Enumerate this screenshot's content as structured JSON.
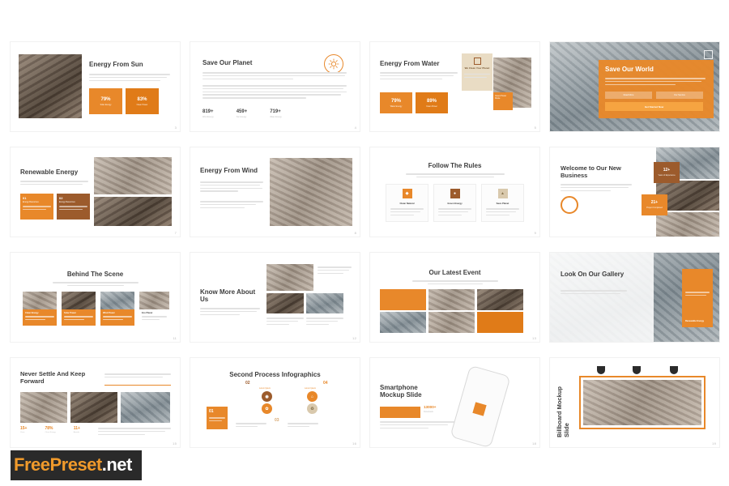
{
  "watermark": {
    "brand": "FreePreset",
    "suffix": ".net"
  },
  "palette": {
    "orange": "#e8882a",
    "orange_dark": "#e07b18",
    "brown": "#9c5b2c",
    "tan": "#d9c9ad",
    "text_dark": "#3d3d3d",
    "body_gray": "#bdbdbd",
    "page_bg": "#ffffff"
  },
  "body_text": "Lorem ipsum dolor sit amet, consectetur adipiscing elit, sed do eiusmod tempor incididunt ut labore et dolore magna aliqua. Ut enim ad minim veniam.",
  "slides": [
    {
      "number": "3",
      "title": "Energy From Sun",
      "stats": [
        {
          "value": "79%",
          "label": "Solar Energy"
        },
        {
          "value": "83%",
          "label": "Clean Power"
        }
      ]
    },
    {
      "number": "4",
      "title": "Save Our Planet",
      "stats": [
        {
          "value": "819+",
          "label": "Wind Energy"
        },
        {
          "value": "459+",
          "label": "Sun Energy"
        },
        {
          "value": "719+",
          "label": "Water Energy"
        }
      ],
      "icon": "sun-burst-icon"
    },
    {
      "number": "5",
      "title": "Energy From Water",
      "sidebar_title": "We Clean Your Planet",
      "sidebar_tag": "Green Power Route",
      "stats": [
        {
          "value": "79%",
          "label": "Water Energy"
        },
        {
          "value": "89%",
          "label": "Clean Power"
        }
      ]
    },
    {
      "number": "6",
      "title": "Save Our World",
      "buttons": [
        "Read More",
        "Our Service"
      ],
      "cta": "Get Started Now"
    },
    {
      "number": "7",
      "title": "Renewable Energy",
      "items": [
        {
          "index": "01",
          "label": "Energy Resources"
        },
        {
          "index": "02",
          "label": "Energy Resources"
        }
      ]
    },
    {
      "number": "8",
      "title": "Energy From Wind"
    },
    {
      "number": "9",
      "title": "Follow The Rules",
      "cards": [
        {
          "label": "Clean Natural"
        },
        {
          "label": "Green Energy"
        },
        {
          "label": "Save Planet"
        }
      ]
    },
    {
      "number": "10",
      "title": "Welcome to Our New Business",
      "stats": [
        {
          "value": "12+",
          "label": "Years of Experience"
        },
        {
          "value": "21+",
          "label": "Project Completed"
        }
      ]
    },
    {
      "number": "11",
      "title": "Behind The Scene",
      "cards": [
        {
          "label": "Clean Energy"
        },
        {
          "label": "Solar Power"
        },
        {
          "label": "Wind Power"
        },
        {
          "label": "Eco Planet"
        }
      ]
    },
    {
      "number": "12",
      "title": "Know More About Us"
    },
    {
      "number": "13",
      "title": "Our Latest Event"
    },
    {
      "number": "14",
      "title": "Look On Our Gallery",
      "panel_label": "Renewable Energy"
    },
    {
      "number": "15",
      "title": "Never Settle And Keep Forward",
      "stats": [
        {
          "value": "15+",
          "label": "Years"
        },
        {
          "value": "78%",
          "label": "Clean Energy"
        },
        {
          "value": "11+",
          "label": "Awards"
        }
      ]
    },
    {
      "number": "16",
      "title": "Second Process Infographics",
      "steps": [
        {
          "index": "01",
          "label": "Lorem Ipsum"
        },
        {
          "index": "02",
          "label": "Lorem Ipsum"
        },
        {
          "index": "03",
          "label": "Lorem Ipsum"
        },
        {
          "index": "04",
          "label": "Lorem Ipsum"
        }
      ]
    },
    {
      "number": "18",
      "title": "Smartphone Mockup Slide",
      "stat": {
        "value": "13000+",
        "label": "Downloads"
      }
    },
    {
      "number": "19",
      "title": "Billboard Mockup Slide"
    }
  ]
}
